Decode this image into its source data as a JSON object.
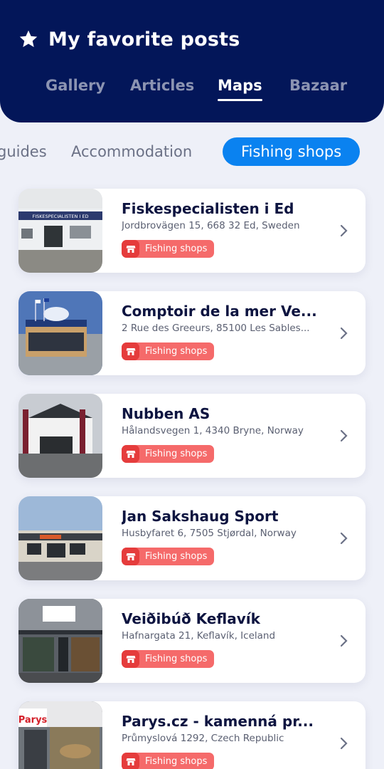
{
  "header": {
    "icon": "star-icon",
    "title": "My favorite posts",
    "background": "#031659"
  },
  "tabs": [
    {
      "label": "Gallery",
      "active": false
    },
    {
      "label": "Articles",
      "active": false
    },
    {
      "label": "Maps",
      "active": true
    },
    {
      "label": "Bazaar",
      "active": false
    }
  ],
  "filters": [
    {
      "label": "guides",
      "active": false
    },
    {
      "label": "Accommodation",
      "active": false
    },
    {
      "label": "Fishing shops",
      "active": true
    }
  ],
  "accent_color": "#0a82f0",
  "badge_color": "#f56a6a",
  "places": [
    {
      "name": "Fiskespecialisten i Ed",
      "address": "Jordbrovägen 15, 668 32 Ed, Sweden",
      "category": "Fishing shops",
      "category_icon": "shop-icon",
      "sign": "FISKESPECIALISTEN I ED"
    },
    {
      "name": "Comptoir de la mer Ve...",
      "address": "2 Rue des Greeurs, 85100 Les Sables...",
      "category": "Fishing shops",
      "category_icon": "shop-icon"
    },
    {
      "name": "Nubben AS",
      "address": "Hålandsvegen 1, 4340 Bryne, Norway",
      "category": "Fishing shops",
      "category_icon": "shop-icon"
    },
    {
      "name": "Jan Sakshaug Sport",
      "address": "Husbyfaret 6, 7505 Stjørdal, Norway",
      "category": "Fishing shops",
      "category_icon": "shop-icon"
    },
    {
      "name": "Veiðibúð Keflavík",
      "address": "Hafnargata 21, Keflavík, Iceland",
      "category": "Fishing shops",
      "category_icon": "shop-icon"
    },
    {
      "name": "Parys.cz - kamenná pr...",
      "address": "Průmyslová 1292, Czech Republic",
      "category": "Fishing shops",
      "category_icon": "shop-icon",
      "sign": "Parys"
    }
  ]
}
